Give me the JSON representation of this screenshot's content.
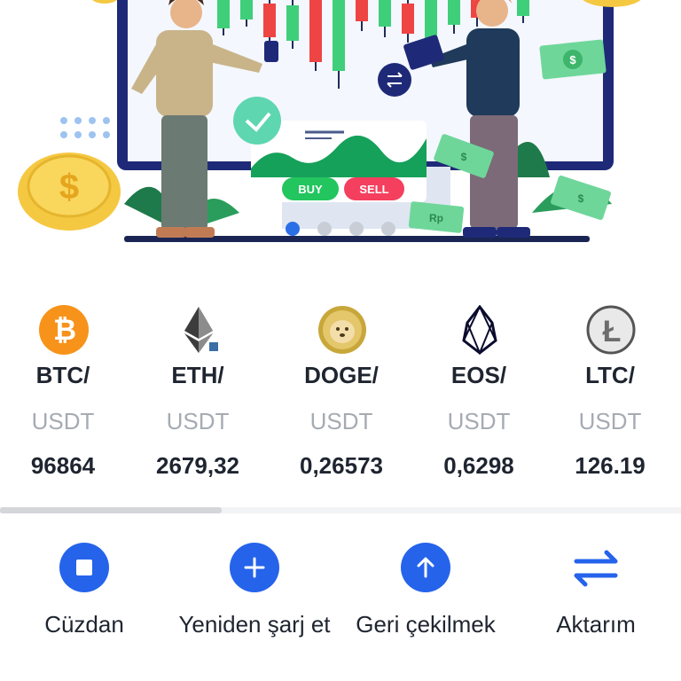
{
  "banner": {
    "buy_label": "BUY",
    "sell_label": "SELL",
    "coin_symbol": "$",
    "bill_symbols": [
      "$",
      "$",
      "Rp",
      "$"
    ],
    "carousel_page_count": 4,
    "carousel_active_index": 0
  },
  "tickers": [
    {
      "symbol": "BTC/",
      "quote": "USDT",
      "price": "96864",
      "icon": "bitcoin-icon"
    },
    {
      "symbol": "ETH/",
      "quote": "USDT",
      "price": "2679,32",
      "icon": "ethereum-icon"
    },
    {
      "symbol": "DOGE/",
      "quote": "USDT",
      "price": "0,26573",
      "icon": "dogecoin-icon"
    },
    {
      "symbol": "EOS/",
      "quote": "USDT",
      "price": "0,6298",
      "icon": "eos-icon"
    },
    {
      "symbol": "LTC/",
      "quote": "USDT",
      "price": "126.19",
      "icon": "litecoin-icon"
    }
  ],
  "actions": [
    {
      "label": "Cüzdan",
      "icon": "wallet-stop-icon"
    },
    {
      "label": "Yeniden şarj et",
      "icon": "plus-icon"
    },
    {
      "label": "Geri çekilmek",
      "icon": "arrow-up-icon"
    },
    {
      "label": "Aktarım",
      "icon": "transfer-arrows-icon"
    }
  ],
  "colors": {
    "accent": "#2563eb",
    "buy": "#22c55e",
    "sell": "#f43f5e",
    "bitcoin": "#f7931a",
    "muted_text": "#a6abb3"
  }
}
